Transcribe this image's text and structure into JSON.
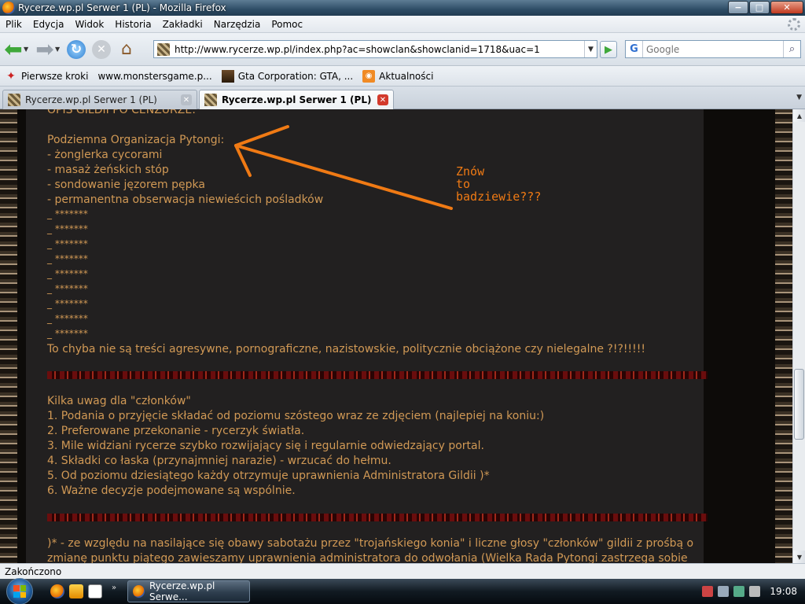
{
  "window": {
    "title": "Rycerze.wp.pl Serwer 1 (PL) - Mozilla Firefox",
    "buttons": {
      "minimize": "−",
      "maximize": "□",
      "close": "✕"
    }
  },
  "menu": [
    "Plik",
    "Edycja",
    "Widok",
    "Historia",
    "Zakładki",
    "Narzędzia",
    "Pomoc"
  ],
  "nav": {
    "url": "http://www.rycerze.wp.pl/index.php?ac=showclan&showclanid=1718&uac=1",
    "search_placeholder": "Google",
    "search_engine": "G"
  },
  "bookmarks": [
    {
      "label": "Pierwsze kroki",
      "icon": "firefox-red-icon"
    },
    {
      "label": "www.monstersgame.p...",
      "icon": "page-icon"
    },
    {
      "label": "Gta Corporation: GTA, ...",
      "icon": "gta-icon"
    },
    {
      "label": "Aktualności",
      "icon": "rss-icon"
    }
  ],
  "tabs": [
    {
      "label": "Rycerze.wp.pl Serwer 1 (PL)",
      "active": false
    },
    {
      "label": "Rycerze.wp.pl Serwer 1 (PL)",
      "active": true
    }
  ],
  "content": {
    "header_partial": "OPIS GILDII PO CENZURZE:",
    "org_title": "Podziemna Organizacja Pytongi:",
    "items": [
      "- żonglerka cycorami",
      "- masaż żeńskich stóp",
      "- sondowanie jęzorem pępka",
      "- permanentna obserwacja niewieścich pośladków"
    ],
    "censored": [
      "_ *******",
      "_ *******",
      "_ *******",
      "_ *******",
      "_ *******",
      "_ *******",
      "_ *******",
      "_ *******",
      "_ *******"
    ],
    "question": "To chyba nie są treści agresywne, pornograficzne, nazistowskie, politycznie obciążone czy nielegalne ?!?!!!!!",
    "rules_title": "Kilka uwag dla \"członków\"",
    "rules": [
      "1. Podania o przyjęcie składać od poziomu szóstego wraz ze zdjęciem (najlepiej na koniu:)",
      "2. Preferowane przekonanie - rycerzyk światła.",
      "3. Mile widziani rycerze szybko rozwijający się i regularnie odwiedzający portal.",
      "4. Składki co łaska (przynajmniej narazie) - wrzucać do hełmu.",
      "5. Od poziomu dziesiątego każdy otrzymuje uprawnienia Administratora Gildii )*",
      "6. Ważne decyzje podejmowane są wspólnie."
    ],
    "footnote_1": ")* - ze względu na nasilające się obawy sabotażu przez \"trojańskiego konia\" i liczne głosy \"członków\" gildii z prośbą o",
    "footnote_2": "zmianę punktu piątego zawieszamy uprawnienia administratora do odwołania (Wielka Rada Pytongi zastrzega sobie",
    "annotation": "Znów\nto\nbadziewie???",
    "text_color": "#d19955",
    "annotation_color": "#f07a14"
  },
  "status": "Zakończono",
  "taskbar": {
    "task_label": "Rycerze.wp.pl Serwe...",
    "quicklaunch_more": "»",
    "clock": "19:08"
  }
}
